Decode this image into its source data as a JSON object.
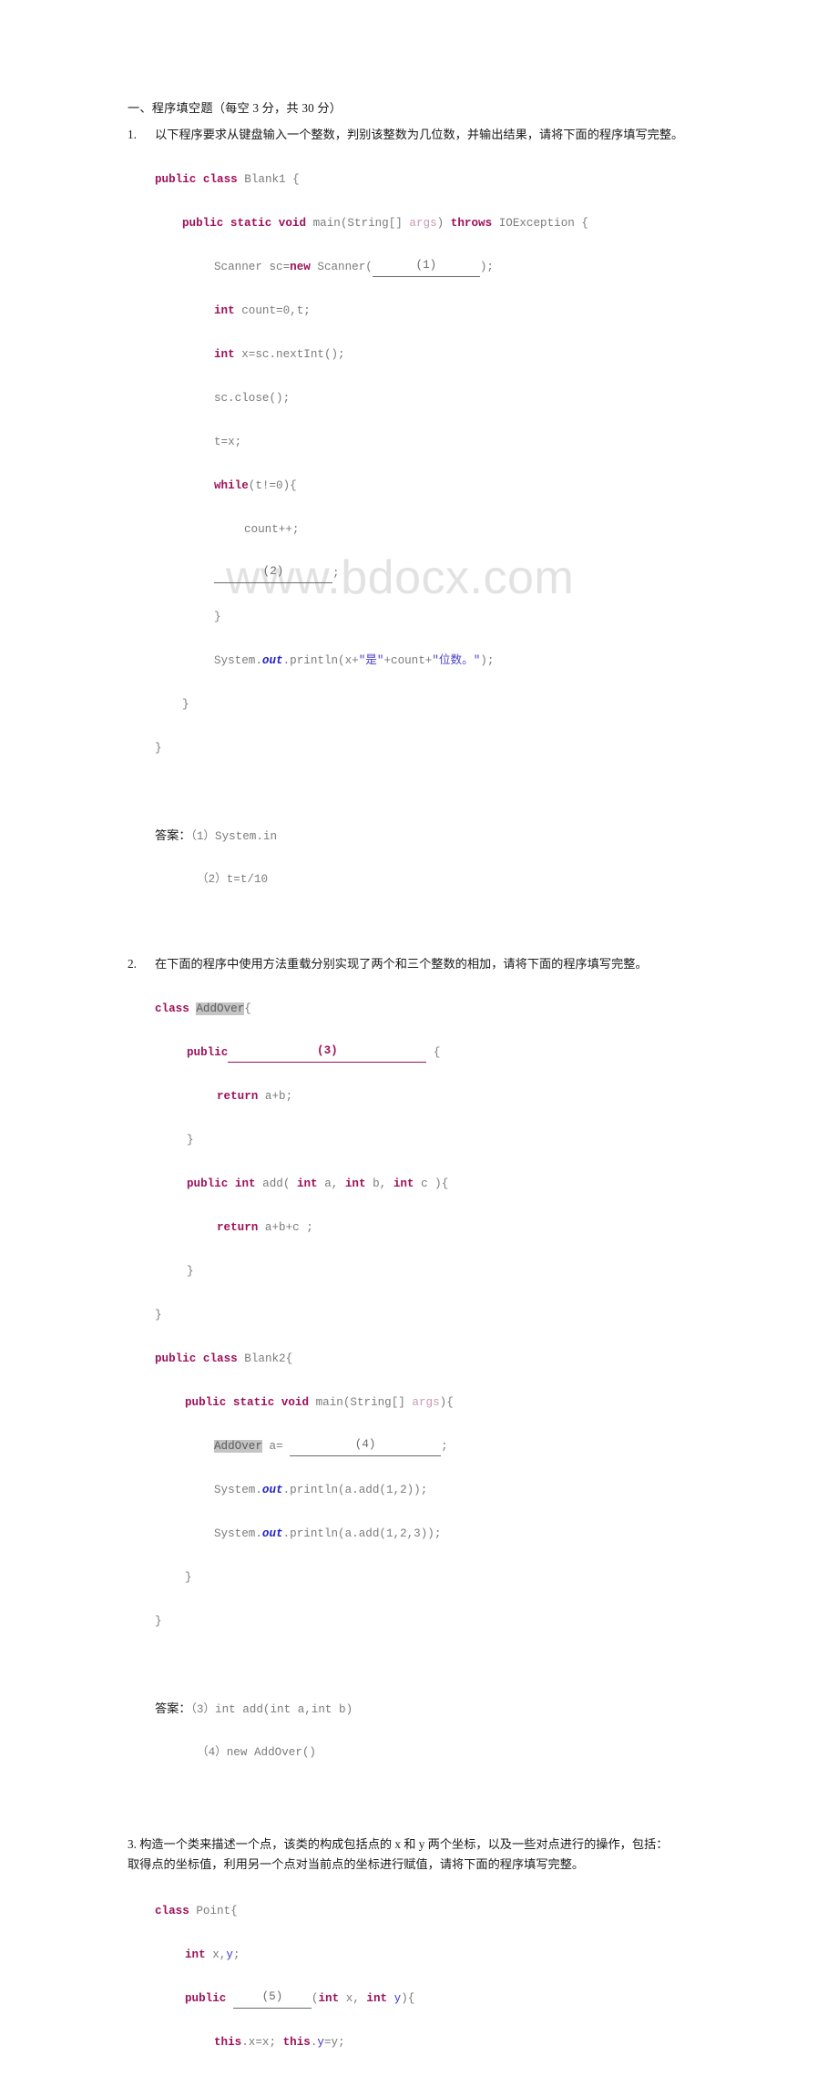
{
  "document": {
    "watermark": "www.bdocx.com",
    "section_heading": "一、程序填空题（每空 3 分，共 30 分）",
    "answer_label": "答案："
  },
  "questions": [
    {
      "number": "1.",
      "prompt": "以下程序要求从键盘输入一个整数，判别该整数为几位数，并输出结果，请将下面的程序填写完整。",
      "code_lines": [
        "public class Blank1 {",
        "    public static void main(String[] args) throws IOException {",
        "        Scanner sc=new Scanner(______(1)________);",
        "        int count=0,t;",
        "        int x=sc.nextInt();",
        "        sc.close();",
        "        t=x;",
        "        while(t!=0){",
        "            count++;",
        "            ________(2)________;",
        "        }",
        "        System.out.println(x+\"是\"+count+\"位数。\");",
        "    }",
        "}"
      ],
      "answers": [
        "（1）System.in",
        "（2）t=t/10"
      ]
    },
    {
      "number": "2.",
      "prompt": "在下面的程序中使用方法重载分别实现了两个和三个整数的相加，请将下面的程序填写完整。",
      "code_lines": [
        "class AddOver{",
        "    public________(3)__________ {",
        "        return a+b;",
        "    }",
        "    public int add( int a, int b, int c ){",
        "        return a+b+c ;",
        "    }",
        "}",
        "public class Blank2{",
        "    public static void main(String[] args){",
        "        AddOver a= ________(4)____________;",
        "        System.out.println(a.add(1,2));",
        "        System.out.println(a.add(1,2,3));",
        "    }",
        "}"
      ],
      "answers": [
        "（3）int add(int a,int b)",
        "（4）new AddOver()"
      ]
    },
    {
      "number": "3.",
      "prompt_line_1": "3. 构造一个类来描述一个点，该类的构成包括点的 x 和 y 两个坐标，以及一些对点进行的操作，包括：",
      "prompt_line_2": "取得点的坐标值，利用另一个点对当前点的坐标进行赋值，请将下面的程序填写完整。",
      "code_lines": [
        "class Point{",
        "    int x,y;",
        "    public ___(5)_____(int x, int y){",
        "        this.x=x; this.y=y;"
      ]
    }
  ],
  "tokens": {
    "blank1": "(1)",
    "blank2": "(2)",
    "blank3": "(3)",
    "blank4": "(4)",
    "blank5": "(5)"
  },
  "colors": {
    "keyword": "#9e1059",
    "identifier": "#7b7b7b",
    "string": "#4a3fd0",
    "field": "#2222cc",
    "highlight_bg": "#c4c4c4",
    "watermark": "#e2e2e2",
    "blank_rule": "#9e1059"
  }
}
